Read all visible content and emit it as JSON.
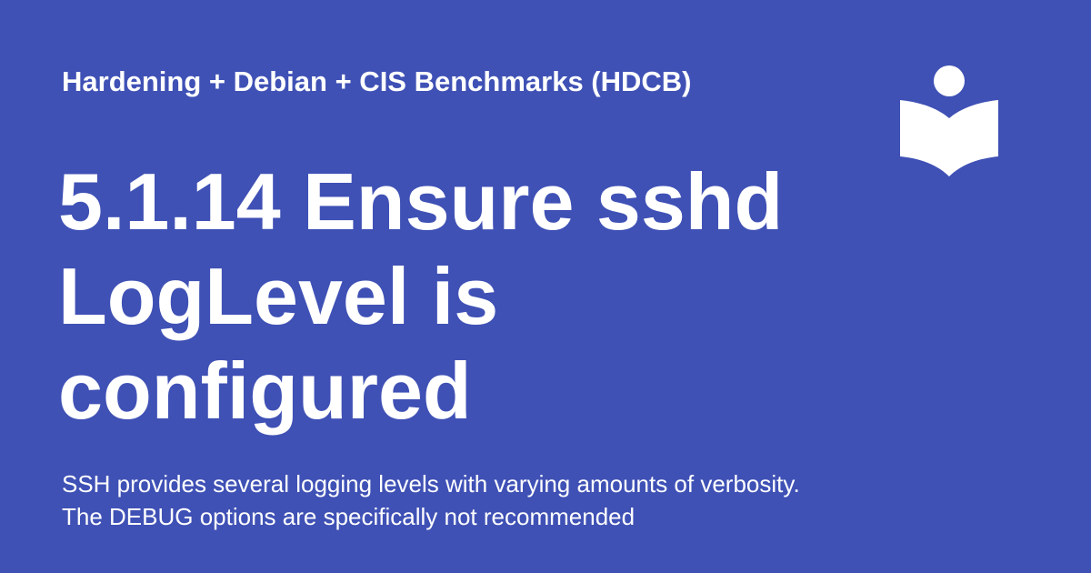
{
  "header": {
    "site_name": "Hardening + Debian + CIS Benchmarks (HDCB)",
    "logo_icon": "reader-book-icon"
  },
  "main": {
    "title": "5.1.14 Ensure sshd LogLevel is configured",
    "description": "SSH provides several logging levels with varying amounts of verbosity. The DEBUG options are specifically not recommended"
  },
  "colors": {
    "background": "#3f51b5",
    "text": "#ffffff"
  }
}
